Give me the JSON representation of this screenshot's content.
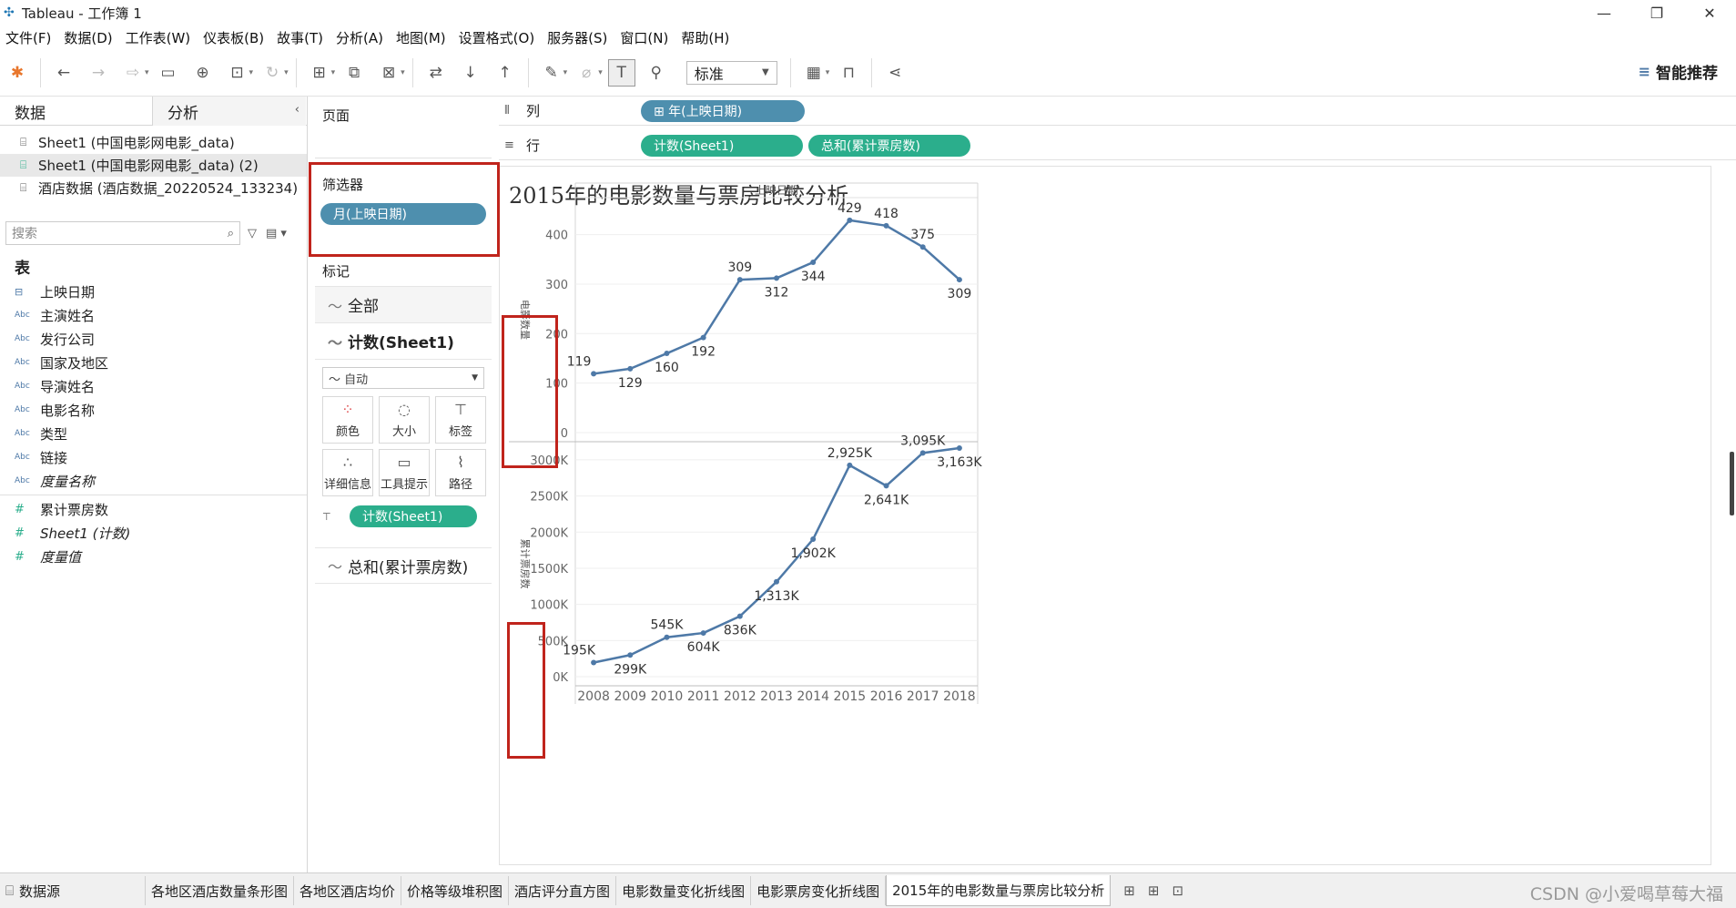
{
  "window": {
    "title": "Tableau - 工作簿 1",
    "minimize": "—",
    "restore": "❐",
    "close": "✕"
  },
  "menu": [
    "文件(F)",
    "数据(D)",
    "工作表(W)",
    "仪表板(B)",
    "故事(T)",
    "分析(A)",
    "地图(M)",
    "设置格式(O)",
    "服务器(S)",
    "窗口(N)",
    "帮助(H)"
  ],
  "toolbar": {
    "fit_select": "标准",
    "smart_recommend": "智能推荐"
  },
  "data_pane": {
    "tab_data": "数据",
    "tab_analysis": "分析",
    "datasources": [
      {
        "label": "Sheet1 (中国电影网电影_data)",
        "selected": false
      },
      {
        "label": "Sheet1 (中国电影网电影_data) (2)",
        "selected": true
      },
      {
        "label": "酒店数据 (酒店数据_20220524_133234)",
        "selected": false
      }
    ],
    "search_placeholder": "搜索",
    "section_table": "表",
    "dimensions": [
      {
        "type": "date",
        "label": "上映日期",
        "italic": false
      },
      {
        "type": "Abc",
        "label": "主演姓名",
        "italic": false
      },
      {
        "type": "Abc",
        "label": "发行公司",
        "italic": false
      },
      {
        "type": "Abc",
        "label": "国家及地区",
        "italic": false
      },
      {
        "type": "Abc",
        "label": "导演姓名",
        "italic": false
      },
      {
        "type": "Abc",
        "label": "电影名称",
        "italic": false
      },
      {
        "type": "Abc",
        "label": "类型",
        "italic": false
      },
      {
        "type": "Abc",
        "label": "链接",
        "italic": false
      },
      {
        "type": "Abc",
        "label": "度量名称",
        "italic": true
      }
    ],
    "measures": [
      {
        "type": "#",
        "label": "累计票房数",
        "italic": false
      },
      {
        "type": "#",
        "label": "Sheet1 (计数)",
        "italic": true
      },
      {
        "type": "#",
        "label": "度量值",
        "italic": true
      }
    ]
  },
  "cards": {
    "pages": "页面",
    "filters": "筛选器",
    "filter_pill": "月(上映日期)",
    "marks": "标记",
    "marks_all": "全部",
    "marks_count": "计数(Sheet1)",
    "mark_type": "自动",
    "mark_buttons": [
      {
        "icon": "color-icon",
        "label": "颜色"
      },
      {
        "icon": "size-icon",
        "label": "大小"
      },
      {
        "icon": "label-icon",
        "label": "标签"
      },
      {
        "icon": "detail-icon",
        "label": "详细信息"
      },
      {
        "icon": "tooltip-icon",
        "label": "工具提示"
      },
      {
        "icon": "path-icon",
        "label": "路径"
      }
    ],
    "mark_label_pill": "计数(Sheet1)",
    "marks_sum": "总和(累计票房数)"
  },
  "shelves": {
    "columns_label": "列",
    "rows_label": "行",
    "columns_pills": [
      "⊞ 年(上映日期)"
    ],
    "rows_pills": [
      "计数(Sheet1)",
      "总和(累计票房数)"
    ]
  },
  "bottom_tabs": {
    "datasource": "数据源",
    "sheets": [
      "各地区酒店数量条形图",
      "各地区酒店均价",
      "价格等级堆积图",
      "酒店评分直方图",
      "电影数量变化折线图",
      "电影票房变化折线图",
      "2015年的电影数量与票房比较分析"
    ],
    "active_index": 6,
    "watermark": "CSDN @小爱喝草莓大福"
  },
  "chart_data": [
    {
      "type": "line",
      "title": "2015年的电影数量与票房比较分析",
      "header": "上映日期",
      "ylabel": "电影数量",
      "x": [
        "2008",
        "2009",
        "2010",
        "2011",
        "2012",
        "2013",
        "2014",
        "2015",
        "2016",
        "2017",
        "2018"
      ],
      "values": [
        119,
        129,
        160,
        192,
        309,
        312,
        344,
        429,
        418,
        375,
        309
      ],
      "labels": [
        "119",
        "129",
        "160",
        "192",
        "309",
        "312",
        "344",
        "429",
        "418",
        "375",
        "309"
      ],
      "ylim": [
        0,
        460
      ],
      "yticks": [
        0,
        100,
        200,
        300,
        400
      ],
      "ytick_labels": [
        "0",
        "100",
        "200",
        "300",
        "400"
      ],
      "grid": true,
      "color": "#4e79a7"
    },
    {
      "type": "line",
      "ylabel": "累计票房数",
      "x": [
        "2008",
        "2009",
        "2010",
        "2011",
        "2012",
        "2013",
        "2014",
        "2015",
        "2016",
        "2017",
        "2018"
      ],
      "values": [
        195,
        299,
        545,
        604,
        836,
        1313,
        1902,
        2925,
        2641,
        3095,
        3163
      ],
      "labels": [
        "195K",
        "299K",
        "545K",
        "604K",
        "836K",
        "1,313K",
        "1,902K",
        "2,925K",
        "2,641K",
        "3,095K",
        "3,163K"
      ],
      "ylim": [
        0,
        3150
      ],
      "yticks": [
        0,
        500,
        1000,
        1500,
        2000,
        2500,
        3000
      ],
      "ytick_labels": [
        "0K",
        "500K",
        "1000K",
        "1500K",
        "2000K",
        "2500K",
        "3000K"
      ],
      "grid": true,
      "color": "#4e79a7"
    }
  ]
}
